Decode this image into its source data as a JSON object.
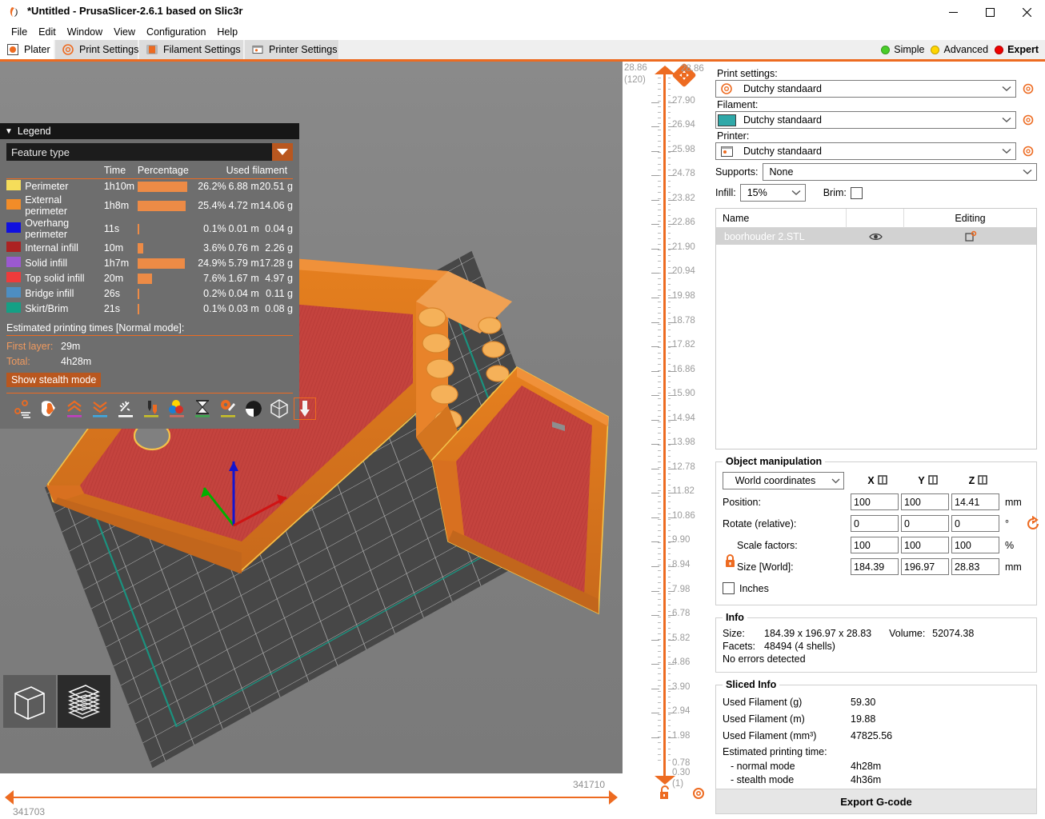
{
  "window": {
    "title": "*Untitled - PrusaSlicer-2.6.1 based on Slic3r",
    "minimize_label": "Minimize",
    "maximize_label": "Maximize",
    "close_label": "Close"
  },
  "menu": [
    "File",
    "Edit",
    "Window",
    "View",
    "Configuration",
    "Help"
  ],
  "tabs": [
    {
      "label": "Plater",
      "icon": "plater-icon",
      "active": true
    },
    {
      "label": "Print Settings",
      "icon": "print-settings-icon",
      "active": false
    },
    {
      "label": "Filament Settings",
      "icon": "filament-settings-icon",
      "active": false
    },
    {
      "label": "Printer Settings",
      "icon": "printer-settings-icon",
      "active": false
    }
  ],
  "modes": [
    {
      "label": "Simple",
      "color": "#49cd29",
      "selected": false
    },
    {
      "label": "Advanced",
      "color": "#ffd500",
      "selected": false
    },
    {
      "label": "Expert",
      "color": "#ee0000",
      "selected": true
    }
  ],
  "legend": {
    "title": "Legend",
    "view_type": "Feature type",
    "columns": [
      "",
      "",
      "Time",
      "Percentage",
      "Used filament",
      ""
    ],
    "rows": [
      {
        "color": "#f5dd5a",
        "name": "Perimeter",
        "time": "1h10m",
        "pct": "26.2%",
        "pct_value": 26.2,
        "length": "6.88 m",
        "weight": "20.51 g"
      },
      {
        "color": "#f28c28",
        "name": "External perimeter",
        "time": "1h8m",
        "pct": "25.4%",
        "pct_value": 25.4,
        "length": "4.72 m",
        "weight": "14.06 g"
      },
      {
        "color": "#1010e0",
        "name": "Overhang perimeter",
        "time": "11s",
        "pct": "0.1%",
        "pct_value": 0.1,
        "length": "0.01 m",
        "weight": "0.04 g"
      },
      {
        "color": "#ac2222",
        "name": "Internal infill",
        "time": "10m",
        "pct": "3.6%",
        "pct_value": 3.6,
        "length": "0.76 m",
        "weight": "2.26 g"
      },
      {
        "color": "#9b59d0",
        "name": "Solid infill",
        "time": "1h7m",
        "pct": "24.9%",
        "pct_value": 24.9,
        "length": "5.79 m",
        "weight": "17.28 g"
      },
      {
        "color": "#ee3b3b",
        "name": "Top solid infill",
        "time": "20m",
        "pct": "7.6%",
        "pct_value": 7.6,
        "length": "1.67 m",
        "weight": "4.97 g"
      },
      {
        "color": "#4d8ec2",
        "name": "Bridge infill",
        "time": "26s",
        "pct": "0.2%",
        "pct_value": 0.2,
        "length": "0.04 m",
        "weight": "0.11 g"
      },
      {
        "color": "#14a085",
        "name": "Skirt/Brim",
        "time": "21s",
        "pct": "0.1%",
        "pct_value": 0.1,
        "length": "0.03 m",
        "weight": "0.08 g"
      }
    ],
    "estimated_header": "Estimated printing times [Normal mode]:",
    "first_layer_label": "First layer:",
    "first_layer_value": "29m",
    "total_label": "Total:",
    "total_value": "4h28m",
    "stealth_button": "Show stealth mode",
    "tools": [
      "travel-paths-icon",
      "retractions-icon",
      "seams-icon",
      "deretractions-icon",
      "wipe-icon",
      "tool-changes-icon",
      "color-changes-icon",
      "pause-prints-icon",
      "custom-gcodes-icon",
      "shells-icon",
      "legend-icon",
      "tool-marker-icon"
    ]
  },
  "viewmodes": [
    {
      "name": "3d-editor-view",
      "active": false
    },
    {
      "name": "preview-view",
      "active": true
    }
  ],
  "horizontal_slider": {
    "high_value": "341710",
    "low_value": "341703"
  },
  "vertical_slider": {
    "top_value": "28.86",
    "top_layer": "(120)",
    "knob_value": "28.86",
    "bottom_value_a": "0.78",
    "bottom_value_b": "0.30",
    "bottom_layer": "(1)",
    "ticks": [
      "27.90",
      "26.94",
      "25.98",
      "24.78",
      "23.82",
      "22.86",
      "21.90",
      "20.94",
      "19.98",
      "18.78",
      "17.82",
      "16.86",
      "15.90",
      "14.94",
      "13.98",
      "12.78",
      "11.82",
      "10.86",
      "9.90",
      "8.94",
      "7.98",
      "6.78",
      "5.82",
      "4.86",
      "3.90",
      "2.94",
      "1.98"
    ],
    "lock_icon": "unlocked-icon",
    "gear_icon": "gear-icon"
  },
  "sidebar": {
    "print_settings_label": "Print settings:",
    "print_settings_value": "Dutchy standaard",
    "filament_label": "Filament:",
    "filament_value": "Dutchy standaard",
    "filament_color": "#2fa8a8",
    "printer_label": "Printer:",
    "printer_value": "Dutchy standaard",
    "supports_label": "Supports:",
    "supports_value": "None",
    "infill_label": "Infill:",
    "infill_value": "15%",
    "brim_label": "Brim:",
    "brim_checked": false,
    "object_list": {
      "columns": [
        "Name",
        "",
        "Editing"
      ],
      "rows": [
        {
          "name": "boorhouder 2.STL",
          "eye": "eye-icon",
          "editing": "editing-icon"
        }
      ]
    },
    "object_manipulation": {
      "title": "Object manipulation",
      "coordinates": "World coordinates",
      "axes": [
        "X",
        "Y",
        "Z"
      ],
      "rows": [
        {
          "label": "Position:",
          "values": [
            "100",
            "100",
            "14.41"
          ],
          "unit": "mm"
        },
        {
          "label": "Rotate (relative):",
          "values": [
            "0",
            "0",
            "0"
          ],
          "unit": "°"
        },
        {
          "label": "Scale factors:",
          "values": [
            "100",
            "100",
            "100"
          ],
          "unit": "%"
        },
        {
          "label": "Size [World]:",
          "values": [
            "184.39",
            "196.97",
            "28.83"
          ],
          "unit": "mm"
        }
      ],
      "inches_label": "Inches",
      "inches_checked": false,
      "lock_icon": "locked-icon",
      "reset_icon": "reset-rotation-icon"
    },
    "info": {
      "title": "Info",
      "size_label": "Size:",
      "size_value": "184.39 x 196.97 x 28.83",
      "volume_label": "Volume:",
      "volume_value": "52074.38",
      "facets_label": "Facets:",
      "facets_value": "48494 (4 shells)",
      "errors": "No errors detected"
    },
    "sliced_info": {
      "title": "Sliced Info",
      "rows": [
        {
          "label": "Used Filament (g)",
          "value": "59.30"
        },
        {
          "label": "Used Filament (m)",
          "value": "19.88"
        },
        {
          "label": "Used Filament (mm³)",
          "value": "47825.56"
        }
      ],
      "time_header": "Estimated printing time:",
      "time_rows": [
        {
          "label": "- normal mode",
          "value": "4h28m"
        },
        {
          "label": "- stealth mode",
          "value": "4h36m"
        }
      ]
    },
    "export_button": "Export G-code"
  },
  "colors": {
    "accent": "#ed6b21",
    "bed": "#474747",
    "background": "#808080"
  }
}
